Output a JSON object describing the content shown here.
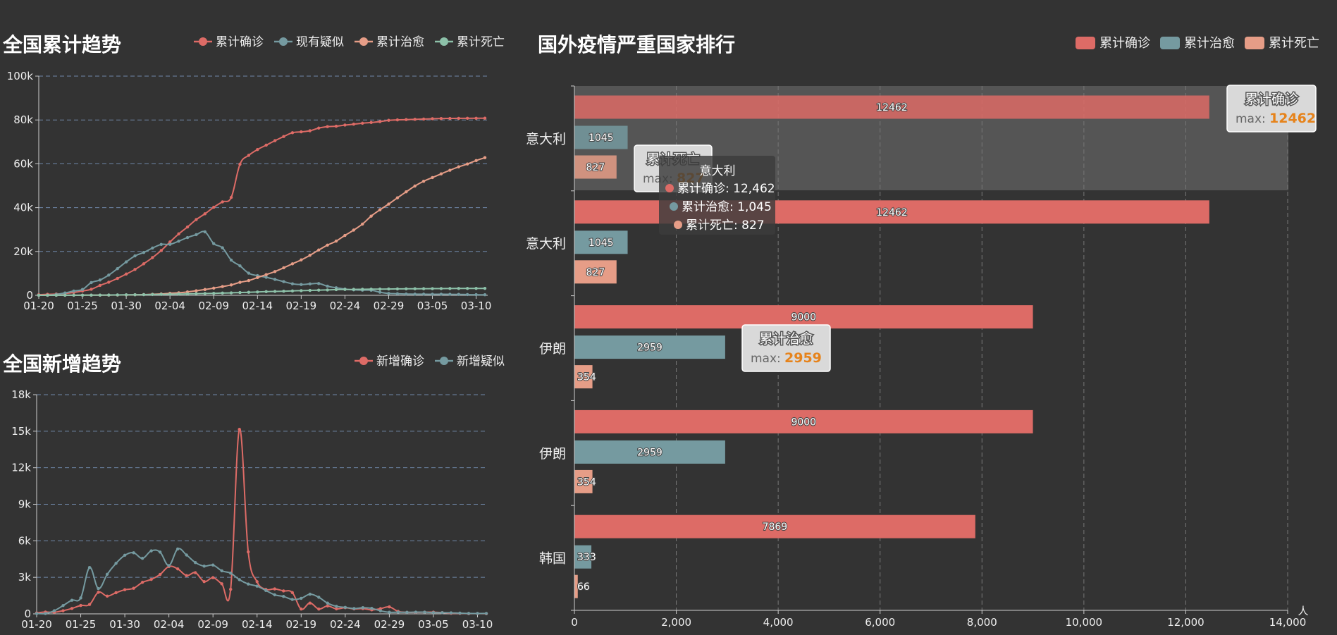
{
  "chart_data": [
    {
      "type": "line",
      "title": "全国累计趋势",
      "categories": [
        "01-20",
        "01-21",
        "01-22",
        "01-23",
        "01-24",
        "01-25",
        "01-26",
        "01-27",
        "01-28",
        "01-29",
        "01-30",
        "01-31",
        "02-01",
        "02-02",
        "02-03",
        "02-04",
        "02-05",
        "02-06",
        "02-07",
        "02-08",
        "02-09",
        "02-10",
        "02-11",
        "02-12",
        "02-13",
        "02-14",
        "02-15",
        "02-16",
        "02-17",
        "02-18",
        "02-19",
        "02-20",
        "02-21",
        "02-22",
        "02-23",
        "02-24",
        "02-25",
        "02-26",
        "02-27",
        "02-28",
        "02-29",
        "03-01",
        "03-02",
        "03-03",
        "03-04",
        "03-05",
        "03-06",
        "03-07",
        "03-08",
        "03-09",
        "03-10",
        "03-11"
      ],
      "tick_labels": [
        "01-20",
        "01-25",
        "01-30",
        "02-04",
        "02-09",
        "02-14",
        "02-19",
        "02-24",
        "02-29",
        "03-05",
        "03-10"
      ],
      "y_ticks": [
        "0",
        "20k",
        "40k",
        "60k",
        "80k",
        "100k"
      ],
      "ylim": [
        0,
        100000
      ],
      "grid": true,
      "legend_position": "top-right",
      "series": [
        {
          "name": "累计确诊",
          "color": "#dd6b66",
          "values": [
            291,
            440,
            571,
            830,
            1287,
            1975,
            2744,
            4515,
            5974,
            7711,
            9692,
            11791,
            14380,
            17205,
            20438,
            24324,
            28018,
            31161,
            34546,
            37198,
            40171,
            42638,
            44653,
            59804,
            63851,
            66492,
            68500,
            70548,
            72436,
            74185,
            74576,
            75077,
            76288,
            76936,
            77150,
            77658,
            78064,
            78497,
            78824,
            79251,
            79824,
            80026,
            80151,
            80270,
            80409,
            80552,
            80651,
            80695,
            80735,
            80754,
            80778,
            80793
          ]
        },
        {
          "name": "现有疑似",
          "color": "#759aa0",
          "values": [
            54,
            37,
            393,
            1072,
            1965,
            2684,
            5794,
            6973,
            9239,
            12167,
            15238,
            17988,
            19544,
            21558,
            23214,
            23260,
            24702,
            26359,
            27657,
            28942,
            23589,
            21675,
            16067,
            13435,
            10109,
            8969,
            8228,
            7264,
            6242,
            5248,
            4922,
            5206,
            5365,
            4148,
            3434,
            2824,
            2491,
            2358,
            2308,
            1418,
            851,
            715,
            587,
            520,
            522,
            482,
            502,
            458,
            421,
            349,
            285,
            253
          ]
        },
        {
          "name": "累计治愈",
          "color": "#e69d87",
          "values": [
            25,
            25,
            28,
            34,
            38,
            49,
            51,
            60,
            103,
            124,
            171,
            243,
            328,
            475,
            632,
            892,
            1153,
            1540,
            2050,
            2649,
            3281,
            3996,
            4740,
            5911,
            6723,
            8096,
            9419,
            10844,
            12552,
            14376,
            16155,
            18264,
            20659,
            22888,
            24734,
            27323,
            29745,
            32495,
            36117,
            39002,
            41625,
            44462,
            47204,
            49856,
            52045,
            53726,
            55404,
            57065,
            58600,
            59897,
            61475,
            62793
          ]
        },
        {
          "name": "累计死亡",
          "color": "#8dc1a9",
          "values": [
            6,
            9,
            17,
            25,
            41,
            56,
            80,
            106,
            132,
            170,
            213,
            259,
            304,
            361,
            425,
            490,
            563,
            636,
            722,
            811,
            908,
            1016,
            1113,
            1259,
            1380,
            1523,
            1665,
            1770,
            1868,
            2004,
            2118,
            2236,
            2345,
            2442,
            2592,
            2663,
            2715,
            2744,
            2788,
            2835,
            2870,
            2912,
            2943,
            2981,
            3012,
            3042,
            3070,
            3097,
            3119,
            3136,
            3158,
            3169
          ]
        }
      ]
    },
    {
      "type": "line",
      "title": "全国新增趋势",
      "categories": [
        "01-20",
        "01-21",
        "01-22",
        "01-23",
        "01-24",
        "01-25",
        "01-26",
        "01-27",
        "01-28",
        "01-29",
        "01-30",
        "01-31",
        "02-01",
        "02-02",
        "02-03",
        "02-04",
        "02-05",
        "02-06",
        "02-07",
        "02-08",
        "02-09",
        "02-10",
        "02-11",
        "02-12",
        "02-13",
        "02-14",
        "02-15",
        "02-16",
        "02-17",
        "02-18",
        "02-19",
        "02-20",
        "02-21",
        "02-22",
        "02-23",
        "02-24",
        "02-25",
        "02-26",
        "02-27",
        "02-28",
        "02-29",
        "03-01",
        "03-02",
        "03-03",
        "03-04",
        "03-05",
        "03-06",
        "03-07",
        "03-08",
        "03-09",
        "03-10",
        "03-11"
      ],
      "tick_labels": [
        "01-20",
        "01-25",
        "01-30",
        "02-04",
        "02-09",
        "02-14",
        "02-19",
        "02-24",
        "02-29",
        "03-05",
        "03-10"
      ],
      "y_ticks": [
        "0",
        "3k",
        "6k",
        "9k",
        "12k",
        "15k",
        "18k"
      ],
      "ylim": [
        0,
        18000
      ],
      "grid": true,
      "legend_position": "top-right",
      "series": [
        {
          "name": "新增确诊",
          "color": "#dd6b66",
          "values": [
            77,
            149,
            131,
            259,
            444,
            688,
            769,
            1771,
            1459,
            1737,
            1982,
            2102,
            2590,
            2829,
            3235,
            3887,
            3694,
            3143,
            3385,
            2652,
            2973,
            2467,
            2015,
            15152,
            5090,
            2641,
            2009,
            2048,
            1886,
            1749,
            394,
            889,
            397,
            648,
            409,
            508,
            406,
            433,
            327,
            427,
            573,
            202,
            125,
            119,
            139,
            143,
            99,
            44,
            40,
            19,
            24,
            15
          ]
        },
        {
          "name": "新增疑似",
          "color": "#759aa0",
          "values": [
            27,
            26,
            257,
            680,
            1118,
            1309,
            3806,
            2077,
            3248,
            4148,
            4812,
            5019,
            4562,
            5173,
            5072,
            3971,
            5328,
            4833,
            4214,
            3916,
            4008,
            3536,
            3342,
            2807,
            2450,
            2277,
            1918,
            1563,
            1432,
            1185,
            1277,
            1614,
            1361,
            882,
            620,
            530,
            439,
            508,
            452,
            248,
            132,
            141,
            129,
            143,
            143,
            102,
            99,
            83,
            60,
            36,
            31,
            33
          ]
        }
      ]
    },
    {
      "type": "bar",
      "orientation": "horizontal",
      "title": "国外疫情严重国家排行",
      "categories": [
        "意大利",
        "意大利",
        "伊朗",
        "伊朗",
        "韩国"
      ],
      "x_ticks": [
        "0",
        "2,000",
        "4,000",
        "6,000",
        "8,000",
        "10,000",
        "12,000",
        "14,000"
      ],
      "xlim": [
        0,
        14000
      ],
      "x_unit": "人",
      "grid": true,
      "legend_position": "top-right",
      "series": [
        {
          "name": "累计确诊",
          "color": "#dd6b66",
          "values": [
            12462,
            12462,
            9000,
            9000,
            7869
          ],
          "value_labels": [
            "12462",
            "12462",
            "9000",
            "9000",
            "7869"
          ]
        },
        {
          "name": "累计治愈",
          "color": "#759aa0",
          "values": [
            1045,
            1045,
            2959,
            2959,
            333
          ],
          "value_labels": [
            "1045",
            "1045",
            "2959",
            "2959",
            "333"
          ]
        },
        {
          "name": "累计死亡",
          "color": "#e69d87",
          "values": [
            827,
            827,
            354,
            354,
            66
          ],
          "value_labels": [
            "827",
            "827",
            "354",
            "354",
            "66"
          ]
        }
      ],
      "mark_points": [
        {
          "series": "累计确诊",
          "title": "累计确诊",
          "label": "max: ",
          "value": "12462"
        },
        {
          "series": "累计治愈",
          "title": "累计治愈",
          "label": "max: ",
          "value": "2959"
        },
        {
          "series": "累计死亡",
          "title": "累计死亡",
          "label": "max: ",
          "value": "827"
        }
      ],
      "tooltip": {
        "title": "意大利",
        "rows": [
          {
            "color": "#dd6b66",
            "text": "累计确诊: 12,462"
          },
          {
            "color": "#759aa0",
            "text": "累计治愈: 1,045"
          },
          {
            "color": "#e69d87",
            "text": "累计死亡: 827"
          }
        ]
      }
    }
  ]
}
